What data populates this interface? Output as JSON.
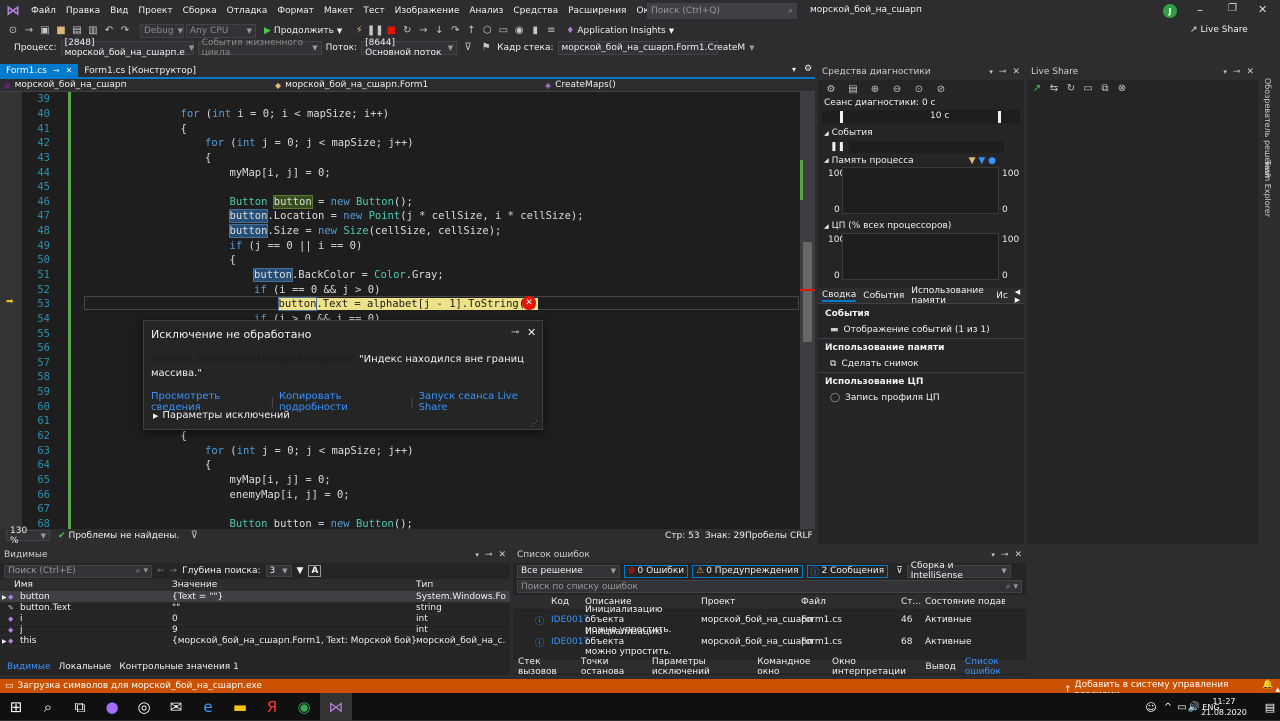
{
  "titlebar": {
    "menu": [
      "Файл",
      "Правка",
      "Вид",
      "Проект",
      "Сборка",
      "Отладка",
      "Формат",
      "Макет",
      "Тест",
      "Изображение",
      "Анализ",
      "Средства",
      "Расширения",
      "Окно",
      "Справка"
    ],
    "search_placeholder": "Поиск (Ctrl+Q)",
    "solution_name": "морской_бой_на_сшарп",
    "avatar": "J"
  },
  "toolbar1": {
    "config": "Debug",
    "platform": "Any CPU",
    "continue_label": "Продолжить",
    "insights_label": "Application Insights",
    "liveshare_label": "Live Share"
  },
  "toolbar2": {
    "process_label": "Процесс:",
    "process_value": "[2848] морской_бой_на_сшарп.e",
    "lifecycle_label": "События жизненного цикла",
    "thread_label": "Поток:",
    "thread_value": "[8644] Основной поток",
    "stack_label": "Кадр стека:",
    "stack_value": "морской_бой_на_сшарп.Form1.CreateM"
  },
  "editor": {
    "tabs": [
      "Form1.cs",
      "Form1.cs [Конструктор]"
    ],
    "nav_project": "морской_бой_на_сшарп",
    "nav_class": "морской_бой_на_сшарп.Form1",
    "nav_method": "CreateMaps()",
    "lines": [
      {
        "n": "39",
        "t": []
      },
      {
        "n": "40",
        "t": [
          [
            "kw",
            "for"
          ],
          [
            "tx",
            " ("
          ],
          [
            "kw",
            "int"
          ],
          [
            "tx",
            " i = 0; i < mapSize; i++)"
          ]
        ],
        "ind": 1
      },
      {
        "n": "41",
        "t": [
          [
            "tx",
            "{"
          ]
        ],
        "ind": 1
      },
      {
        "n": "42",
        "t": [
          [
            "kw",
            "for"
          ],
          [
            "tx",
            " ("
          ],
          [
            "kw",
            "int"
          ],
          [
            "tx",
            " j = 0; j < mapSize; j++)"
          ]
        ],
        "ind": 2
      },
      {
        "n": "43",
        "t": [
          [
            "tx",
            "{"
          ]
        ],
        "ind": 2
      },
      {
        "n": "44",
        "t": [
          [
            "tx",
            "myMap[i, j] = 0;"
          ]
        ],
        "ind": 3
      },
      {
        "n": "45",
        "t": [],
        "ind": 3
      },
      {
        "n": "46",
        "t": [
          [
            "ty",
            "Button"
          ],
          [
            "tx",
            " "
          ],
          [
            "hlg",
            "button"
          ],
          [
            "tx",
            " = "
          ],
          [
            "kw",
            "new"
          ],
          [
            "tx",
            " "
          ],
          [
            "ty",
            "Button"
          ],
          [
            "tx",
            "();"
          ]
        ],
        "ind": 3
      },
      {
        "n": "47",
        "t": [
          [
            "hl",
            "button"
          ],
          [
            "tx",
            ".Location = "
          ],
          [
            "kw",
            "new"
          ],
          [
            "tx",
            " "
          ],
          [
            "ty",
            "Point"
          ],
          [
            "tx",
            "(j * cellSize, i * cellSize);"
          ]
        ],
        "ind": 3
      },
      {
        "n": "48",
        "t": [
          [
            "hl",
            "button"
          ],
          [
            "tx",
            ".Size = "
          ],
          [
            "kw",
            "new"
          ],
          [
            "tx",
            " "
          ],
          [
            "ty",
            "Size"
          ],
          [
            "tx",
            "(cellSize, cellSize);"
          ]
        ],
        "ind": 3
      },
      {
        "n": "49",
        "t": [
          [
            "kw",
            "if"
          ],
          [
            "tx",
            " (j == 0 || i == 0)"
          ]
        ],
        "ind": 3
      },
      {
        "n": "50",
        "t": [
          [
            "tx",
            "{"
          ]
        ],
        "ind": 3
      },
      {
        "n": "51",
        "t": [
          [
            "hl",
            "button"
          ],
          [
            "tx",
            ".BackColor = "
          ],
          [
            "ty",
            "Color"
          ],
          [
            "tx",
            ".Gray;"
          ]
        ],
        "ind": 4
      },
      {
        "n": "52",
        "t": [
          [
            "kw",
            "if"
          ],
          [
            "tx",
            " (i == 0 && j > 0)"
          ]
        ],
        "ind": 4
      },
      {
        "n": "53",
        "t": [
          [
            "hl",
            "button"
          ],
          [
            "cur",
            ".Text = alphabet[j - 1].ToString();"
          ]
        ],
        "ind": 5
      },
      {
        "n": "54",
        "t": [
          [
            "kw",
            "if"
          ],
          [
            "tx",
            " (i > 0 && j == 0)"
          ]
        ],
        "ind": 4
      },
      {
        "n": "55",
        "t": []
      },
      {
        "n": "56",
        "t": []
      },
      {
        "n": "57",
        "t": []
      },
      {
        "n": "58",
        "t": []
      },
      {
        "n": "59",
        "t": []
      },
      {
        "n": "60",
        "t": []
      },
      {
        "n": "61",
        "t": []
      },
      {
        "n": "62",
        "t": [
          [
            "tx",
            "{"
          ]
        ],
        "ind": 1
      },
      {
        "n": "63",
        "t": [
          [
            "kw",
            "for"
          ],
          [
            "tx",
            " ("
          ],
          [
            "kw",
            "int"
          ],
          [
            "tx",
            " j = 0; j < mapSize; j++)"
          ]
        ],
        "ind": 2
      },
      {
        "n": "64",
        "t": [
          [
            "tx",
            "{"
          ]
        ],
        "ind": 2
      },
      {
        "n": "65",
        "t": [
          [
            "tx",
            "myMap[i, j] = 0;"
          ]
        ],
        "ind": 3
      },
      {
        "n": "66",
        "t": [
          [
            "tx",
            "enemyMap[i, j] = 0;"
          ]
        ],
        "ind": 3
      },
      {
        "n": "67",
        "t": [],
        "ind": 3
      },
      {
        "n": "68",
        "t": [
          [
            "ty",
            "Button"
          ],
          [
            "tx",
            " button = "
          ],
          [
            "kw",
            "new"
          ],
          [
            "tx",
            " "
          ],
          [
            "ty",
            "Button"
          ],
          [
            "tx",
            "();"
          ]
        ],
        "ind": 3
      }
    ],
    "status_zoom": "130 %",
    "status_problems": "Проблемы не найдены.",
    "status_line": "Стр: 53",
    "status_col": "Знак: 29",
    "status_ws": "Пробелы",
    "status_eol": "CRLF"
  },
  "exception": {
    "title": "Исключение не обработано",
    "type": "System.IndexOutOfRangeException:",
    "message": "\"Индекс находился вне границ массива.\"",
    "link_details": "Просмотреть сведения",
    "link_copy": "Копировать подробности",
    "link_liveshare": "Запуск сеанса Live Share",
    "params": "Параметры исключений"
  },
  "diagnostics": {
    "title": "Средства диагностики",
    "session": "Сеанс диагностики: 0 с",
    "timeline_tick": "10 с",
    "events_label": "События",
    "memory_label": "Память процесса",
    "cpu_label": "ЦП (% всех процессоров)",
    "axis_top": "100",
    "axis_bottom": "0",
    "tabs": [
      "Сводка",
      "События",
      "Использование памяти",
      "Ис"
    ],
    "sec_events": "События",
    "show_events": "Отображение событий (1 из 1)",
    "sec_memory": "Использование памяти",
    "snapshot": "Сделать снимок",
    "sec_cpu": "Использование ЦП",
    "cpu_profile": "Запись профиля ЦП"
  },
  "liveshare_panel": {
    "title": "Live Share"
  },
  "side_tabs": [
    "Обозреватель решений",
    "Team Explorer"
  ],
  "watch": {
    "title": "Видимые",
    "search_placeholder": "Поиск (Ctrl+E)",
    "depth_label": "Глубина поиска:",
    "depth_value": "3",
    "columns": [
      "Имя",
      "Значение",
      "Тип"
    ],
    "rows": [
      {
        "name": "button",
        "value": "{Text = \"\"}",
        "type": "System.Windows.Fo..."
      },
      {
        "name": "button.Text",
        "value": "\"\"",
        "type": "string"
      },
      {
        "name": "i",
        "value": "0",
        "type": "int"
      },
      {
        "name": "j",
        "value": "9",
        "type": "int"
      },
      {
        "name": "this",
        "value": "{морской_бой_на_сшарп.Form1, Text: Морской бой}",
        "type": "морской_бой_на_с..."
      }
    ],
    "bottom_tabs": [
      "Видимые",
      "Локальные",
      "Контрольные значения 1"
    ]
  },
  "errors": {
    "title": "Список ошибок",
    "scope": "Все решение",
    "err_count": "0 Ошибки",
    "warn_count": "0 Предупреждения",
    "msg_count": "2 Сообщения",
    "build_filter": "Сборка и IntelliSense",
    "search_placeholder": "Поиск по списку ошибок",
    "columns": [
      "Код",
      "Описание",
      "Проект",
      "Файл",
      "Ст...",
      "Состояние подавл..."
    ],
    "rows": [
      {
        "code": "IDE0017",
        "desc1": "Инициализацию объекта",
        "desc2": "можно упростить.",
        "project": "морской_бой_на_сшарп",
        "file": "Form1.cs",
        "line": "46",
        "state": "Активные"
      },
      {
        "code": "IDE0017",
        "desc1": "Инициализацию объекта",
        "desc2": "можно упростить.",
        "project": "морской_бой_на_сшарп",
        "file": "Form1.cs",
        "line": "68",
        "state": "Активные"
      }
    ],
    "bottom_tabs": [
      "Стек вызовов",
      "Точки останова",
      "Параметры исключений",
      "Командное окно",
      "Окно интерпретации",
      "Вывод",
      "Список ошибок"
    ]
  },
  "statusbar": {
    "loading": "Загрузка символов для морской_бой_на_сшарп.exe",
    "source_control": "Добавить в систему управления версиями"
  },
  "taskbar": {
    "lang": "ENG",
    "time": "11:27",
    "date": "21.08.2020"
  },
  "colors": {
    "accent": "#007acc",
    "status": "#ca5100",
    "error": "#e51400",
    "highlight": "#264f78"
  }
}
